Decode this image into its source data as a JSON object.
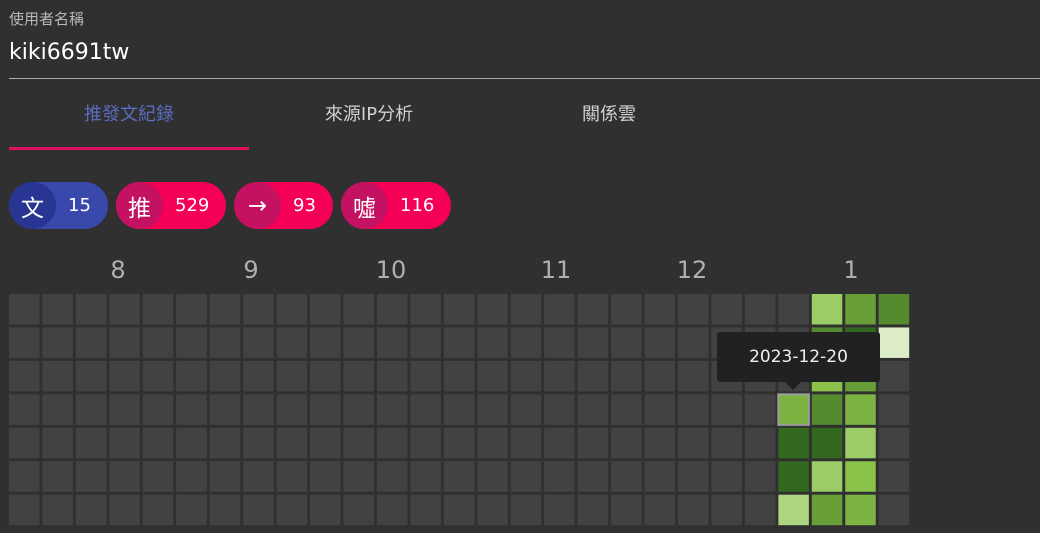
{
  "username_field": {
    "label": "使用者名稱",
    "value": "kiki6691tw"
  },
  "tabs": [
    {
      "label": "推發文紀錄",
      "active": true
    },
    {
      "label": "來源IP分析",
      "active": false
    },
    {
      "label": "關係雲",
      "active": false
    }
  ],
  "stats": [
    {
      "icon": "文",
      "count": "15",
      "color": "blue"
    },
    {
      "icon": "推",
      "count": "529",
      "color": "pink"
    },
    {
      "icon": "→",
      "count": "93",
      "color": "pink"
    },
    {
      "icon": "噓",
      "count": "116",
      "color": "pink"
    }
  ],
  "heatmap": {
    "months": [
      "8",
      "9",
      "10",
      "11",
      "12",
      "1"
    ],
    "colors": [
      "#424242",
      "#dcedc8",
      "#aed581",
      "#9ccc65",
      "#8bc34a",
      "#7cb342",
      "#689f38",
      "#558b2f",
      "#33691e"
    ],
    "weeks": [
      [
        0,
        0,
        0,
        0,
        0,
        0,
        0
      ],
      [
        0,
        0,
        0,
        0,
        0,
        0,
        0
      ],
      [
        0,
        0,
        0,
        0,
        0,
        0,
        0
      ],
      [
        0,
        0,
        0,
        0,
        0,
        0,
        0
      ],
      [
        0,
        0,
        0,
        0,
        0,
        0,
        0
      ],
      [
        0,
        0,
        0,
        0,
        0,
        0,
        0
      ],
      [
        0,
        0,
        0,
        0,
        0,
        0,
        0
      ],
      [
        0,
        0,
        0,
        0,
        0,
        0,
        0
      ],
      [
        0,
        0,
        0,
        0,
        0,
        0,
        0
      ],
      [
        0,
        0,
        0,
        0,
        0,
        0,
        0
      ],
      [
        0,
        0,
        0,
        0,
        0,
        0,
        0
      ],
      [
        0,
        0,
        0,
        0,
        0,
        0,
        0
      ],
      [
        0,
        0,
        0,
        0,
        0,
        0,
        0
      ],
      [
        0,
        0,
        0,
        0,
        0,
        0,
        0
      ],
      [
        0,
        0,
        0,
        0,
        0,
        0,
        0
      ],
      [
        0,
        0,
        0,
        0,
        0,
        0,
        0
      ],
      [
        0,
        0,
        0,
        0,
        0,
        0,
        0
      ],
      [
        0,
        0,
        0,
        0,
        0,
        0,
        0
      ],
      [
        0,
        0,
        0,
        0,
        0,
        0,
        0
      ],
      [
        0,
        0,
        0,
        0,
        0,
        0,
        0
      ],
      [
        0,
        0,
        0,
        0,
        0,
        0,
        0
      ],
      [
        0,
        0,
        0,
        0,
        0,
        0,
        0
      ],
      [
        0,
        0,
        0,
        0,
        0,
        0,
        0
      ],
      [
        0,
        0,
        0,
        5,
        8,
        8,
        2
      ],
      [
        3,
        7,
        4,
        7,
        8,
        3,
        6
      ],
      [
        6,
        8,
        6,
        5,
        3,
        4,
        5
      ],
      [
        7,
        1,
        0,
        0,
        0,
        0,
        0
      ]
    ]
  },
  "tooltip": {
    "text": "2023-12-20"
  }
}
